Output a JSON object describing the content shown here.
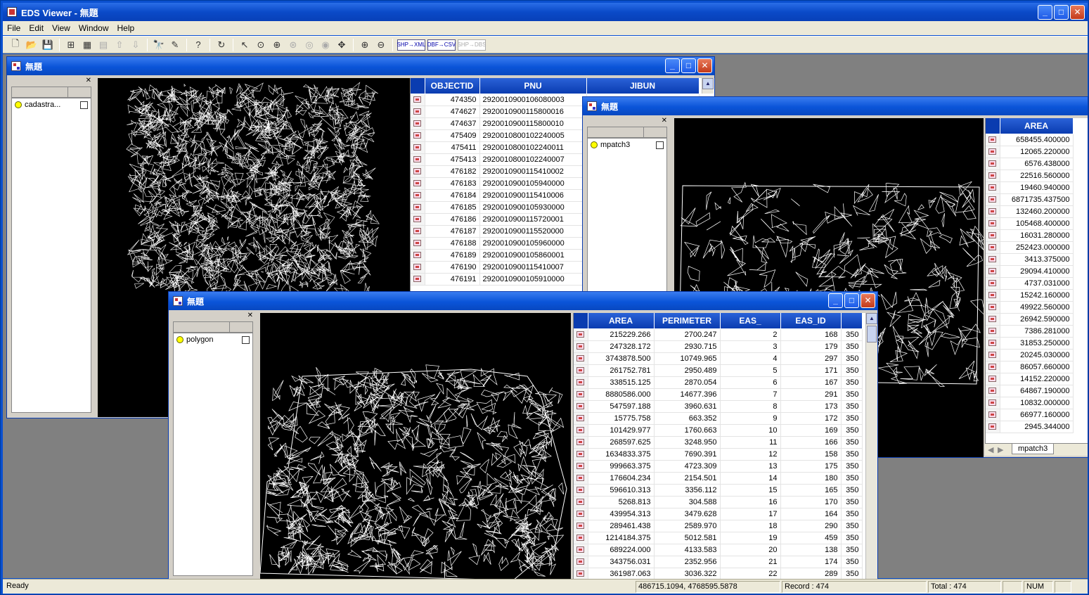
{
  "app": {
    "title": "EDS Viewer - 無題"
  },
  "menu": [
    "File",
    "Edit",
    "View",
    "Window",
    "Help"
  ],
  "toolbar_icons": [
    "new-icon",
    "open-icon",
    "save-icon",
    "add-layer-icon",
    "layer-icon",
    "layer-remove-icon",
    "move-up-icon",
    "move-down-icon",
    "find-icon",
    "query-icon",
    "help-icon",
    "refresh-icon",
    "select-icon",
    "zoom-area-icon",
    "zoom-full-icon",
    "zoom-center-icon",
    "zoom-prev-icon",
    "zoom-next-icon",
    "pan-icon",
    "zoom-in-icon",
    "zoom-out-icon",
    "shp-to-xml-icon",
    "dbf-to-csv-icon",
    "shp-to-dbs-icon"
  ],
  "toolbar_wide": [
    "SHP→XML",
    "DBF→CSV",
    "SHP→DBS"
  ],
  "windows": {
    "w1": {
      "title": "無題",
      "layer": "cadastra...",
      "columns": [
        "OBJECTID",
        "PNU",
        "JIBUN"
      ],
      "rows": [
        [
          "474350",
          "2920010900106080003",
          ""
        ],
        [
          "474627",
          "2920010900115800016",
          ""
        ],
        [
          "474637",
          "2920010900115800010",
          ""
        ],
        [
          "475409",
          "2920010800102240005",
          ""
        ],
        [
          "475411",
          "2920010800102240011",
          ""
        ],
        [
          "475413",
          "2920010800102240007",
          ""
        ],
        [
          "476182",
          "2920010900115410002",
          ""
        ],
        [
          "476183",
          "2920010900105940000",
          ""
        ],
        [
          "476184",
          "2920010900115410006",
          ""
        ],
        [
          "476185",
          "2920010900105930000",
          ""
        ],
        [
          "476186",
          "2920010900115720001",
          ""
        ],
        [
          "476187",
          "2920010900115520000",
          ""
        ],
        [
          "476188",
          "2920010900105960000",
          ""
        ],
        [
          "476189",
          "2920010900105860001",
          ""
        ],
        [
          "476190",
          "2920010900115410007",
          ""
        ],
        [
          "476191",
          "2920010900105910000",
          ""
        ]
      ]
    },
    "w2": {
      "title": "無題",
      "layer": "mpatch3",
      "columns": [
        "AREA"
      ],
      "tab": "mpatch3",
      "rows": [
        "658455.400000",
        "12065.220000",
        "6576.438000",
        "22516.560000",
        "19460.940000",
        "6871735.437500",
        "132460.200000",
        "105468.400000",
        "16031.280000",
        "252423.000000",
        "3413.375000",
        "29094.410000",
        "4737.031000",
        "15242.160000",
        "49922.560000",
        "26942.590000",
        "7386.281000",
        "31853.250000",
        "20245.030000",
        "86057.660000",
        "14152.220000",
        "64867.190000",
        "10832.000000",
        "66977.160000",
        "2945.344000"
      ]
    },
    "w3": {
      "title": "無題",
      "layer": "polygon",
      "columns": [
        "AREA",
        "PERIMETER",
        "EAS_",
        "EAS_ID",
        ""
      ],
      "rows": [
        [
          "215229.266",
          "2700.247",
          "2",
          "168",
          "350"
        ],
        [
          "247328.172",
          "2930.715",
          "3",
          "179",
          "350"
        ],
        [
          "3743878.500",
          "10749.965",
          "4",
          "297",
          "350"
        ],
        [
          "261752.781",
          "2950.489",
          "5",
          "171",
          "350"
        ],
        [
          "338515.125",
          "2870.054",
          "6",
          "167",
          "350"
        ],
        [
          "8880586.000",
          "14677.396",
          "7",
          "291",
          "350"
        ],
        [
          "547597.188",
          "3960.631",
          "8",
          "173",
          "350"
        ],
        [
          "15775.758",
          "663.352",
          "9",
          "172",
          "350"
        ],
        [
          "101429.977",
          "1760.663",
          "10",
          "169",
          "350"
        ],
        [
          "268597.625",
          "3248.950",
          "11",
          "166",
          "350"
        ],
        [
          "1634833.375",
          "7690.391",
          "12",
          "158",
          "350"
        ],
        [
          "999663.375",
          "4723.309",
          "13",
          "175",
          "350"
        ],
        [
          "176604.234",
          "2154.501",
          "14",
          "180",
          "350"
        ],
        [
          "596610.313",
          "3356.112",
          "15",
          "165",
          "350"
        ],
        [
          "5268.813",
          "304.588",
          "16",
          "170",
          "350"
        ],
        [
          "439954.313",
          "3479.628",
          "17",
          "164",
          "350"
        ],
        [
          "289461.438",
          "2589.970",
          "18",
          "290",
          "350"
        ],
        [
          "1214184.375",
          "5012.581",
          "19",
          "459",
          "350"
        ],
        [
          "689224.000",
          "4133.583",
          "20",
          "138",
          "350"
        ],
        [
          "343756.031",
          "2352.956",
          "21",
          "174",
          "350"
        ],
        [
          "361987.063",
          "3036.322",
          "22",
          "289",
          "350"
        ]
      ]
    }
  },
  "status": {
    "ready": "Ready",
    "coords": "486715.1094, 4768595.5878",
    "record": "Record : 474",
    "total": "Total : 474",
    "num": "NUM"
  },
  "colors": {
    "titlebar": "#0a54d8",
    "header": "#0a3cb0",
    "map_bg": "#000000",
    "mdi_bg": "#808080"
  }
}
